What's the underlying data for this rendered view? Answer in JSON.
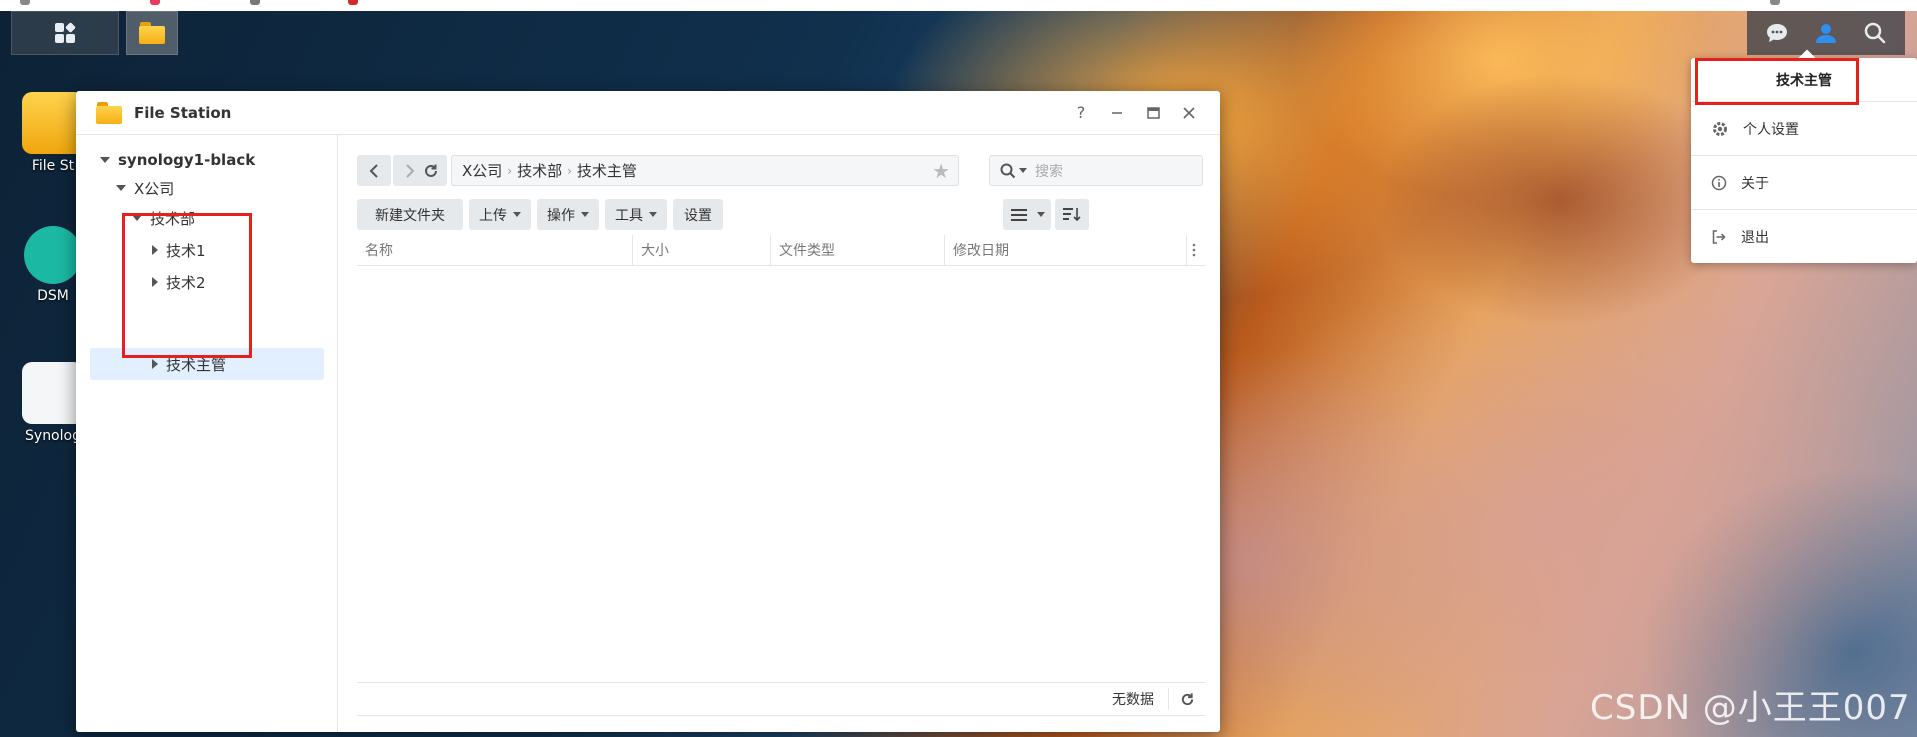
{
  "window": {
    "title": "File Station",
    "help": "?"
  },
  "desktop": {
    "icons": [
      {
        "label": "File St"
      },
      {
        "label": "DSM"
      },
      {
        "label": "Synolog"
      }
    ]
  },
  "tray": {
    "user_menu": {
      "username": "技术主管",
      "items": [
        {
          "label": "个人设置",
          "icon": "gear-icon"
        },
        {
          "label": "关于",
          "icon": "info-icon"
        },
        {
          "label": "退出",
          "icon": "logout-icon"
        }
      ]
    }
  },
  "sidebar": {
    "root": "synology1-black",
    "company": "X公司",
    "department": "技术部",
    "children": [
      {
        "label": "技术1"
      },
      {
        "label": "技术2"
      },
      {
        "label": "技术主管"
      }
    ]
  },
  "toolbar": {
    "path": [
      "X公司",
      "技术部",
      "技术主管"
    ],
    "search_placeholder": "搜索",
    "buttons": {
      "new_folder": "新建文件夹",
      "upload": "上传",
      "action": "操作",
      "tools": "工具",
      "settings": "设置"
    }
  },
  "table": {
    "columns": [
      "名称",
      "大小",
      "文件类型",
      "修改日期"
    ]
  },
  "footer": {
    "status": "无数据"
  },
  "watermark": "CSDN @小王王007",
  "colors": {
    "highlight_box": "#e8201d",
    "selection": "#e2efff",
    "user_accent": "#2e8ff0"
  }
}
